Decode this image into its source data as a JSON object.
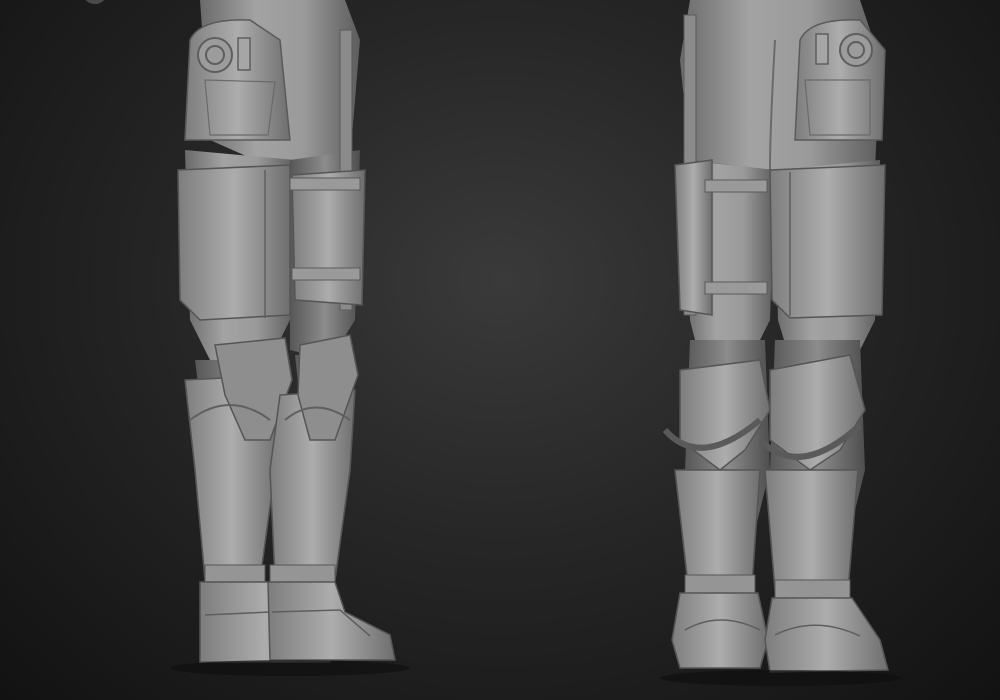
{
  "scene": {
    "background_color": "#1c1c1c",
    "model_color": "#8f8f8f",
    "views": [
      {
        "id": "front",
        "subject": "armored-legs"
      },
      {
        "id": "back",
        "subject": "armored-legs"
      }
    ]
  }
}
